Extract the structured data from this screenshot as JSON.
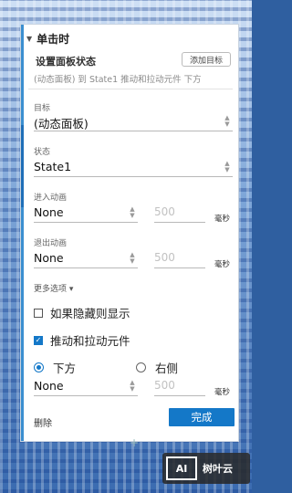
{
  "section": {
    "title": "单击时"
  },
  "action": {
    "title": "设置面板状态",
    "add_target_label": "添加目标",
    "summary": "(动态面板) 到 State1 推动和拉动元件 下方"
  },
  "target": {
    "label": "目标",
    "value": "(动态面板)"
  },
  "state": {
    "label": "状态",
    "value": "State1"
  },
  "enter_anim": {
    "label": "进入动画",
    "value": "None",
    "duration": "500",
    "unit": "毫秒"
  },
  "exit_anim": {
    "label": "退出动画",
    "value": "None",
    "duration": "500",
    "unit": "毫秒"
  },
  "more_options": {
    "label": "更多选项 ▾"
  },
  "options": {
    "show_if_hidden": {
      "label": "如果隐藏则显示",
      "checked": false
    },
    "push_pull": {
      "label": "推动和拉动元件",
      "checked": true
    }
  },
  "direction": {
    "below_label": "下方",
    "right_label": "右侧",
    "selected": "below"
  },
  "push_anim": {
    "value": "None",
    "duration": "500",
    "unit": "毫秒"
  },
  "footer": {
    "delete_label": "删除",
    "done_label": "完成",
    "add_label": "+"
  },
  "watermark": {
    "logo": "AI",
    "text": "树叶云"
  },
  "colors": {
    "accent": "#1478c8",
    "panel_bg": "#ffffff"
  }
}
